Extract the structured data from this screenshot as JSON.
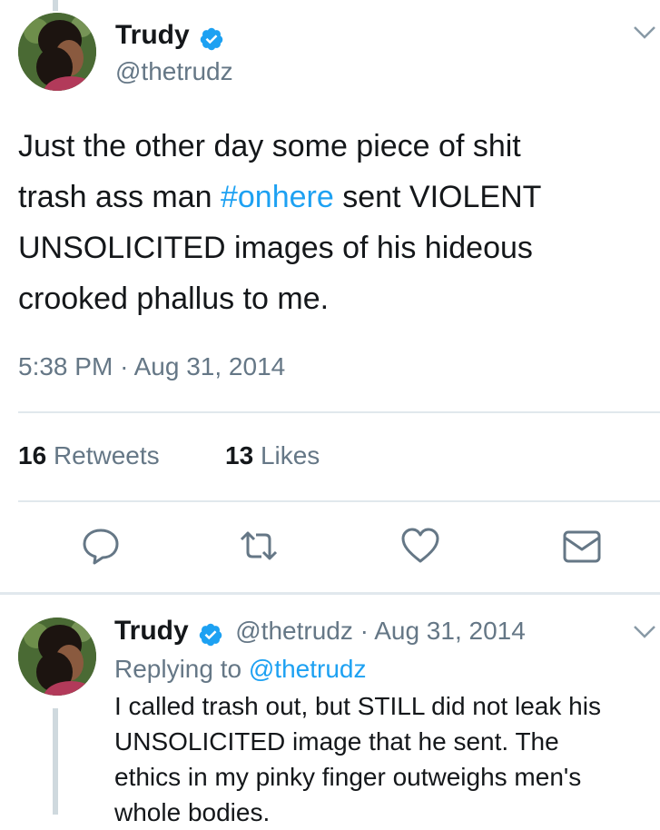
{
  "tweet": {
    "author_name": "Trudy",
    "handle": "@thetrudz",
    "text_lines": [
      [
        "Just the other day some piece of shit",
        "",
        ""
      ],
      [
        "trash ass man ",
        "#onhere",
        " sent VIOLENT"
      ],
      [
        "UNSOLICITED images of his hideous",
        "",
        ""
      ],
      [
        "crooked phallus to me.",
        "",
        ""
      ]
    ],
    "time": "5:38 PM",
    "separator": "·",
    "date": "Aug 31, 2014",
    "retweets_count": "16",
    "retweets_label": "Retweets",
    "likes_count": "13",
    "likes_label": "Likes"
  },
  "reply": {
    "author_name": "Trudy",
    "handle": "@thetrudz",
    "separator": "·",
    "date": "Aug 31, 2014",
    "replying_prefix": "Replying to",
    "replying_to": "@thetrudz",
    "text_lines": [
      "I called trash out, but STILL did not leak his",
      "UNSOLICITED image that he sent. The",
      "ethics in my pinky finger outweighs men's",
      "whole bodies."
    ]
  },
  "icons": {
    "verified": "verified-badge-icon",
    "chevron": "chevron-down-icon",
    "reply": "reply-icon",
    "retweet": "retweet-icon",
    "like": "heart-icon",
    "dm": "envelope-icon"
  },
  "colors": {
    "accent": "#1da1f2",
    "text": "#14171a",
    "secondary": "#657786",
    "divider": "#e1e8ed"
  }
}
